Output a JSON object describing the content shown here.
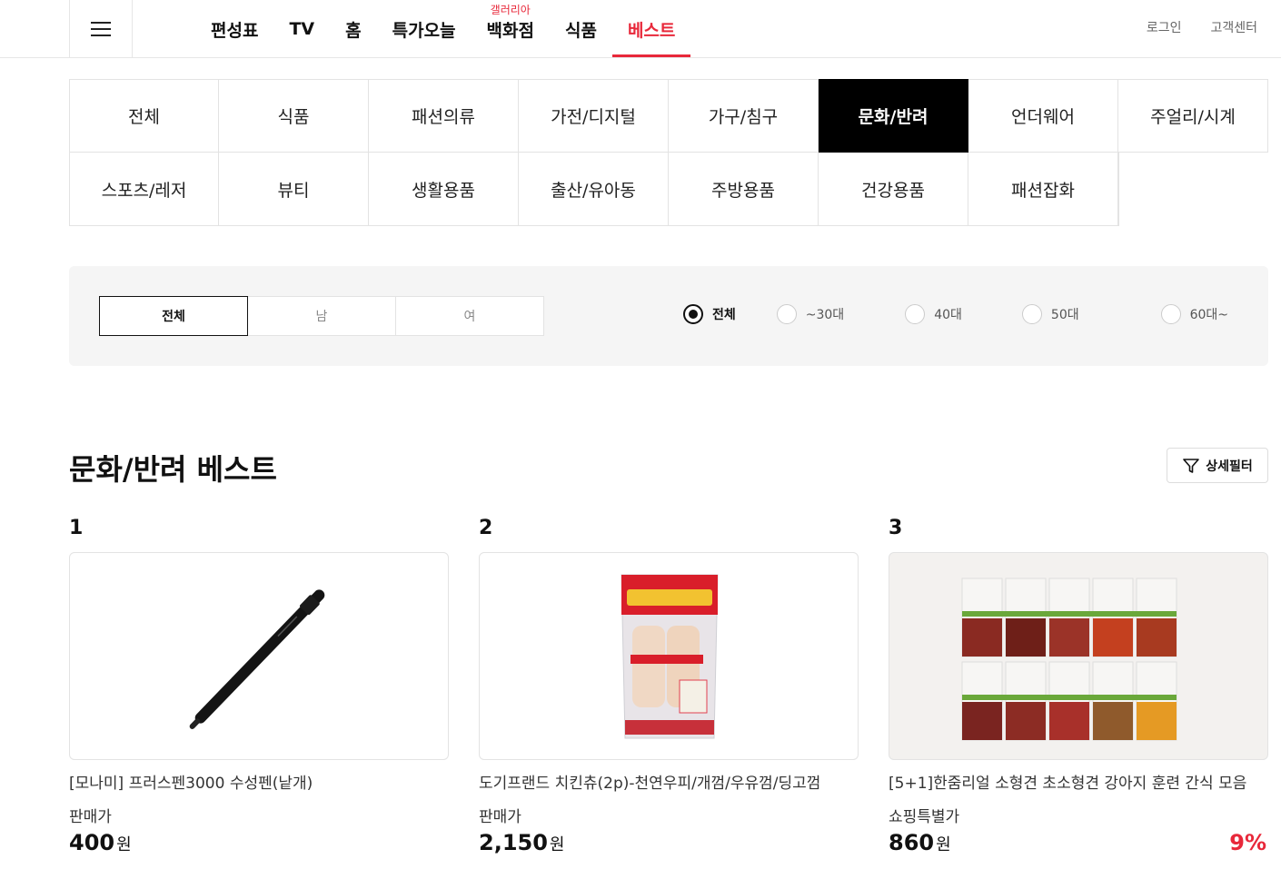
{
  "header": {
    "nav": [
      {
        "label": "편성표",
        "sup": ""
      },
      {
        "label": "TV",
        "sup": ""
      },
      {
        "label": "홈",
        "sup": ""
      },
      {
        "label": "특가오늘",
        "sup": ""
      },
      {
        "label": "백화점",
        "sup": "갤러리아"
      },
      {
        "label": "식품",
        "sup": ""
      },
      {
        "label": "베스트",
        "sup": ""
      }
    ],
    "active_nav": "베스트",
    "login": "로그인",
    "customer_center": "고객센터"
  },
  "categories": [
    "전체",
    "식품",
    "패션의류",
    "가전/디지털",
    "가구/침구",
    "문화/반려",
    "언더웨어",
    "주얼리/시계",
    "스포츠/레저",
    "뷰티",
    "생활용품",
    "출산/유아동",
    "주방용품",
    "건강용품",
    "패션잡화"
  ],
  "active_category": "문화/반려",
  "gender_filter": {
    "options": [
      "전체",
      "남",
      "여"
    ],
    "selected": "전체"
  },
  "age_filter": {
    "options": [
      "전체",
      "~30대",
      "40대",
      "50대",
      "60대~"
    ],
    "selected": "전체"
  },
  "section": {
    "title": "문화/반려 베스트",
    "detail_filter": "상세필터"
  },
  "products": [
    {
      "rank": "1",
      "name": "[모나미] 프러스펜3000 수성펜(낱개)",
      "price_label": "판매가",
      "price": "400",
      "currency": "원",
      "discount": ""
    },
    {
      "rank": "2",
      "name": "도기프랜드 치킨츄(2p)-천연우피/개껌/우유껌/딩고껌",
      "price_label": "판매가",
      "price": "2,150",
      "currency": "원",
      "discount": ""
    },
    {
      "rank": "3",
      "name": "[5+1]한줌리얼 소형견 초소형견 강아지 훈련 간식 모음",
      "price_label": "쇼핑특별가",
      "price": "860",
      "currency": "원",
      "discount": "9%"
    }
  ],
  "colors": {
    "accent": "#e8283a",
    "active_bg": "#000000",
    "filter_bg": "#f5f5f5"
  }
}
